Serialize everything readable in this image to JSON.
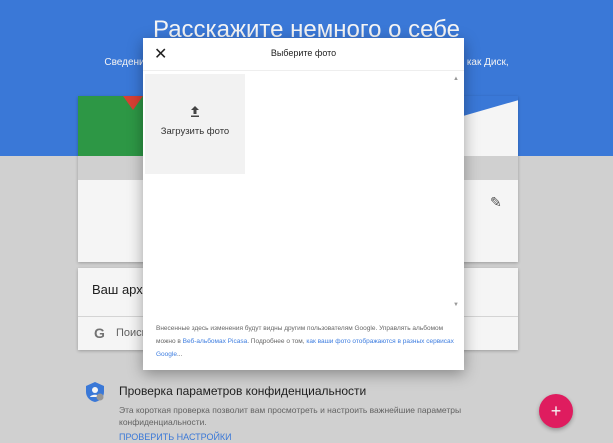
{
  "header": {
    "title": "Расскажите немного о себе",
    "subtitle": "Сведения о себе, которые вы добавите здесь, будут видны в таких сервисах, как Диск,"
  },
  "archive": {
    "title": "Ваш архив",
    "search_label": "Поиск"
  },
  "privacy": {
    "title": "Проверка параметров конфиденциальности",
    "description": "Эта короткая проверка позволит вам просмотреть и настроить важнейшие параметры конфиденциальности.",
    "link": "ПРОВЕРИТЬ НАСТРОЙКИ"
  },
  "dialog": {
    "title": "Выберите фото",
    "upload_label": "Загрузить фото",
    "footer_text_1": "Внесенные здесь изменения будут видны другим пользователям Google. Управлять альбомом можно в ",
    "footer_link_1": "Веб-альбомах Picasa",
    "footer_text_2": ". Подробнее о том, ",
    "footer_link_2": "как ваши фото отображаются в разных сервисах Google",
    "footer_text_3": "..."
  },
  "icons": {
    "close": "close-icon",
    "upload": "upload-icon",
    "edit": "pencil-icon",
    "google": "google-g-icon",
    "privacy": "shield-user-icon",
    "fab": "plus-icon"
  },
  "colors": {
    "header_blue": "#3d7de0",
    "fab_pink": "#e91e63",
    "link_blue": "#3d7de0"
  }
}
